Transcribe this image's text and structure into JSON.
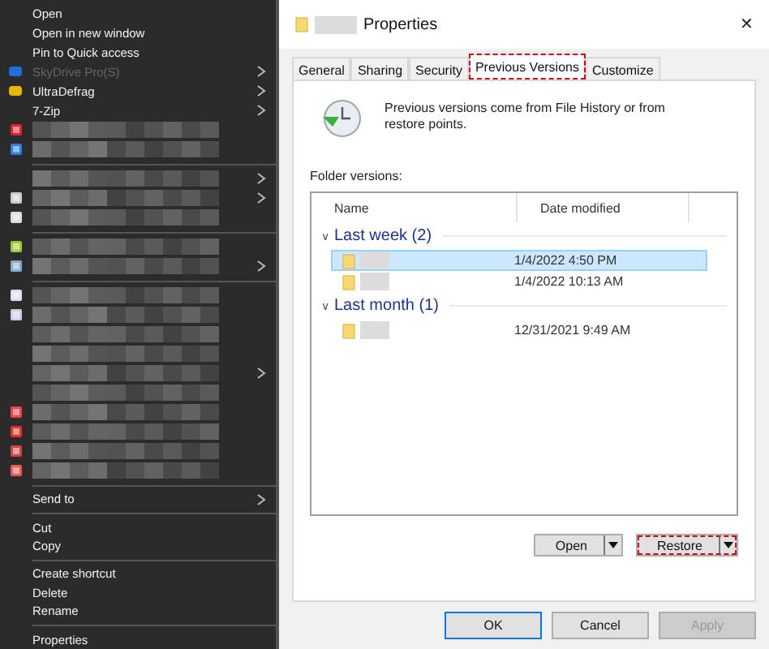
{
  "context_menu": {
    "top_items": [
      {
        "kind": "item",
        "label": "Open",
        "disabled": false,
        "submenu": false
      },
      {
        "kind": "item",
        "label": "Open in new window",
        "disabled": false,
        "submenu": false
      },
      {
        "kind": "item",
        "label": "Pin to Quick access",
        "disabled": false,
        "submenu": false
      },
      {
        "kind": "item",
        "label": "SkyDrive Pro(S)",
        "disabled": true,
        "submenu": true
      },
      {
        "kind": "item",
        "label": "UltraDefrag",
        "disabled": false,
        "submenu": true
      },
      {
        "kind": "item",
        "label": "7-Zip",
        "disabled": false,
        "submenu": true
      }
    ],
    "hidden_items": [
      {
        "kind": "app",
        "submenu": false
      },
      {
        "kind": "app",
        "submenu": false
      },
      {
        "kind": "separator"
      },
      {
        "kind": "blank",
        "submenu": true
      },
      {
        "kind": "app",
        "submenu": true
      },
      {
        "kind": "app",
        "submenu": false
      },
      {
        "kind": "separator"
      },
      {
        "kind": "app",
        "submenu": false
      },
      {
        "kind": "app",
        "submenu": true
      },
      {
        "kind": "separator"
      },
      {
        "kind": "app",
        "submenu": false
      },
      {
        "kind": "app",
        "submenu": false
      },
      {
        "kind": "blank",
        "submenu": false
      },
      {
        "kind": "blank",
        "submenu": false
      },
      {
        "kind": "blank",
        "submenu": true
      },
      {
        "kind": "blank",
        "submenu": false
      },
      {
        "kind": "app",
        "submenu": false
      },
      {
        "kind": "app",
        "submenu": false
      },
      {
        "kind": "app",
        "submenu": false
      },
      {
        "kind": "app",
        "submenu": false
      },
      {
        "kind": "separator"
      }
    ],
    "bottom_items": [
      {
        "kind": "item",
        "label": "Send to",
        "disabled": false,
        "submenu": true
      },
      {
        "kind": "separator"
      },
      {
        "kind": "item",
        "label": "Cut",
        "disabled": false,
        "submenu": false
      },
      {
        "kind": "item",
        "label": "Copy",
        "disabled": false,
        "submenu": false
      },
      {
        "kind": "separator"
      },
      {
        "kind": "item",
        "label": "Create shortcut",
        "disabled": false,
        "submenu": false
      },
      {
        "kind": "item",
        "label": "Delete",
        "disabled": false,
        "submenu": false
      },
      {
        "kind": "item",
        "label": "Rename",
        "disabled": false,
        "submenu": false
      },
      {
        "kind": "separator"
      },
      {
        "kind": "item",
        "label": "Properties",
        "disabled": false,
        "submenu": false
      }
    ]
  },
  "dialog": {
    "title": "Properties",
    "close": "✕",
    "tabs": [
      {
        "label": "General",
        "selected": false,
        "highlighted": false
      },
      {
        "label": "Sharing",
        "selected": false,
        "highlighted": false
      },
      {
        "label": "Security",
        "selected": false,
        "highlighted": false
      },
      {
        "label": "Previous Versions",
        "selected": true,
        "highlighted": true
      },
      {
        "label": "Customize",
        "selected": false,
        "highlighted": false
      }
    ],
    "description": "Previous versions come from File History or from restore points.",
    "list_label": "Folder versions:",
    "columns": [
      "Name",
      "Date modified"
    ],
    "groups": [
      {
        "title": "Last week (2)",
        "expander": "∨",
        "rows": [
          {
            "date": "1/4/2022 4:50 PM",
            "selected": true
          },
          {
            "date": "1/4/2022 10:13 AM",
            "selected": false
          }
        ]
      },
      {
        "title": "Last month (1)",
        "expander": "∨",
        "rows": [
          {
            "date": "12/31/2021 9:49 AM",
            "selected": false
          }
        ]
      }
    ],
    "action_buttons": [
      {
        "label": "Open",
        "highlighted": false
      },
      {
        "label": "Restore",
        "highlighted": true
      }
    ],
    "footer_buttons": [
      {
        "label": "OK",
        "focused": true,
        "disabled": false
      },
      {
        "label": "Cancel",
        "focused": false,
        "disabled": false
      },
      {
        "label": "Apply",
        "focused": false,
        "disabled": true
      }
    ]
  }
}
